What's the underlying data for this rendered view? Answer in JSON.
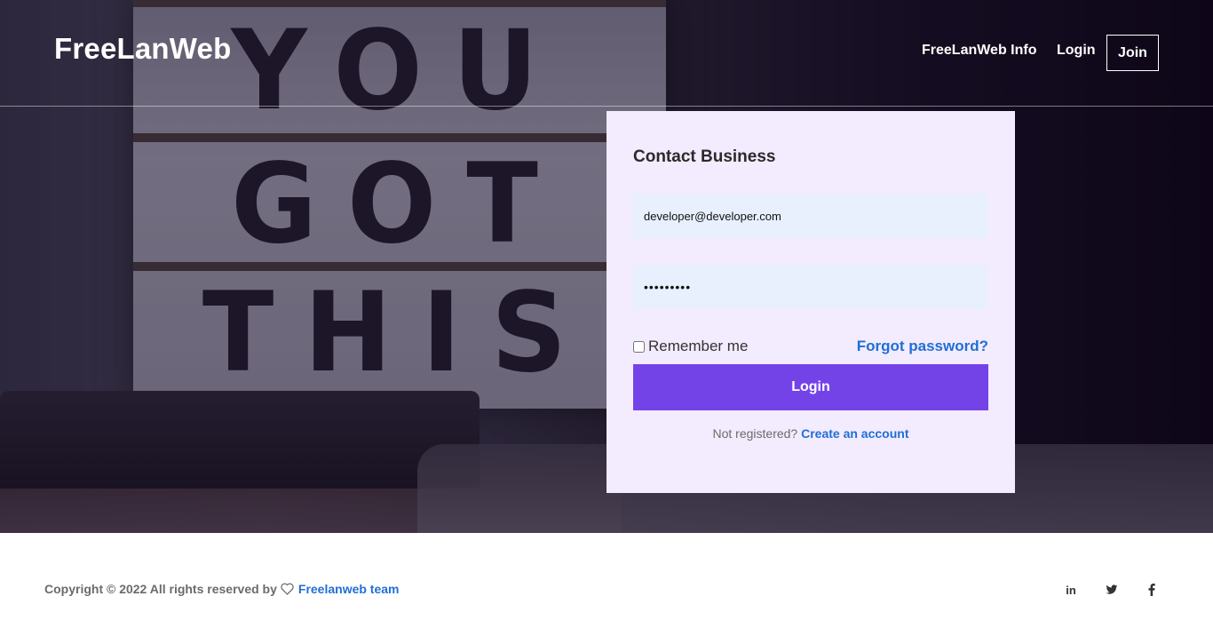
{
  "header": {
    "logo": "FreeLanWeb",
    "nav": {
      "info_label": "FreeLanWeb Info",
      "login_label": "Login",
      "join_label": "Join"
    }
  },
  "hero": {
    "lightbox_words": [
      "YOU",
      "GOT",
      "THIS"
    ]
  },
  "login_card": {
    "title": "Contact Business",
    "email_value": "developer@developer.com",
    "password_value": "•••••••••",
    "remember_label": "Remember me",
    "remember_checked": false,
    "forgot_label": "Forgot password?",
    "submit_label": "Login",
    "register_prompt": "Not registered?",
    "register_link": "Create an account"
  },
  "footer": {
    "copyright_text": "Copyright © 2022 All rights reserved by",
    "team_link": "Freelanweb team",
    "social_icons": [
      "linkedin-icon",
      "twitter-icon",
      "facebook-icon"
    ]
  },
  "colors": {
    "accent": "#7443e8",
    "link": "#1f6fd6",
    "card_bg": "#f3ebfe",
    "input_bg": "#e8f0fe"
  }
}
